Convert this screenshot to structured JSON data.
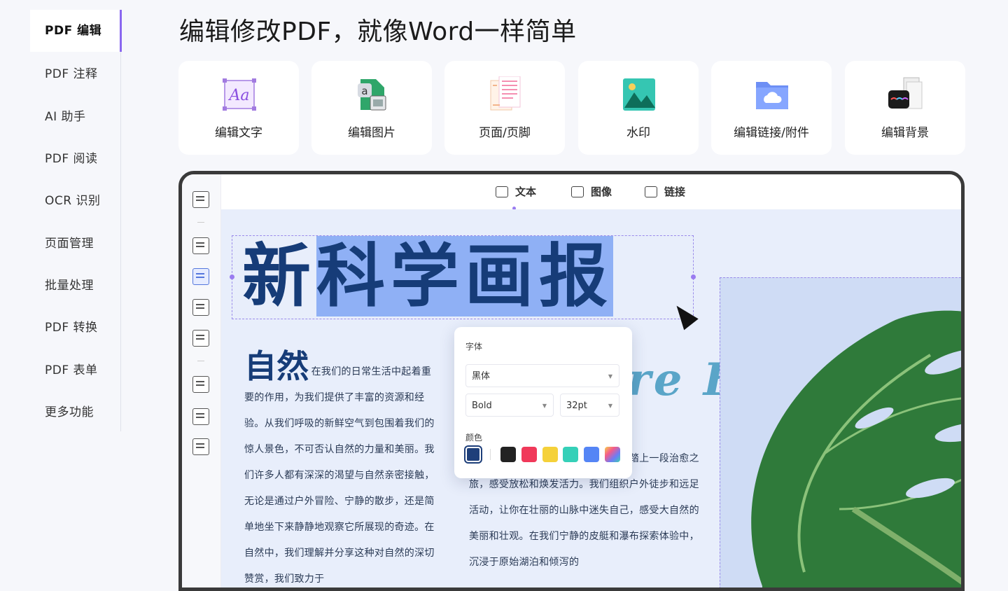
{
  "nav": {
    "items": [
      {
        "label": "PDF 编辑",
        "active": true
      },
      {
        "label": "PDF 注释"
      },
      {
        "label": "AI 助手"
      },
      {
        "label": "PDF 阅读"
      },
      {
        "label": "OCR 识别"
      },
      {
        "label": "页面管理"
      },
      {
        "label": "批量处理"
      },
      {
        "label": "PDF 转换"
      },
      {
        "label": "PDF 表单"
      },
      {
        "label": "更多功能"
      }
    ]
  },
  "header": {
    "title": "编辑修改PDF，就像Word一样简单"
  },
  "features": [
    {
      "label": "编辑文字",
      "icon": "edit-text-icon"
    },
    {
      "label": "编辑图片",
      "icon": "edit-image-icon"
    },
    {
      "label": "页面/页脚",
      "icon": "header-footer-icon"
    },
    {
      "label": "水印",
      "icon": "watermark-icon"
    },
    {
      "label": "编辑链接/附件",
      "icon": "link-attachment-icon"
    },
    {
      "label": "编辑背景",
      "icon": "background-icon"
    }
  ],
  "editor": {
    "toolbar": {
      "text": "文本",
      "image": "图像",
      "link": "链接"
    },
    "magazine": {
      "title_plain": "新",
      "title_selected": "科学画报",
      "overlay_text": "re Fix",
      "col1_heading": "自然",
      "col1_text": "在我们的日常生活中起着重要的作用，为我们提供了丰富的资源和经验。从我们呼吸的新鲜空气到包围着我们的惊人景色，不可否认自然的力量和美丽。我们许多人都有深深的渴望与自然亲密接触，无论是通过户外冒险、宁静的散步，还是简单地坐下来静静地观察它所展现的奇迹。在自然中，我们理解并分享这种对自然的深切赞赏，我们致力于",
      "col2_text": "验到清静的醒来森林。在这里，你将踏上一段治愈之旅，感受放松和焕发活力。我们组织户外徒步和远足活动，让你在壮丽的山脉中迷失自己，感受大自然的美丽和壮观。在我们宁静的皮艇和瀑布探索体验中，沉浸于原始湖泊和倾泻的"
    },
    "font_panel": {
      "font_label": "字体",
      "font_family": "黑体",
      "font_weight": "Bold",
      "font_size": "32pt",
      "color_label": "颜色",
      "colors": [
        "#1e3f7a",
        "#222222",
        "#f0395a",
        "#f5d13a",
        "#35d0b8",
        "#5585f5"
      ]
    }
  }
}
